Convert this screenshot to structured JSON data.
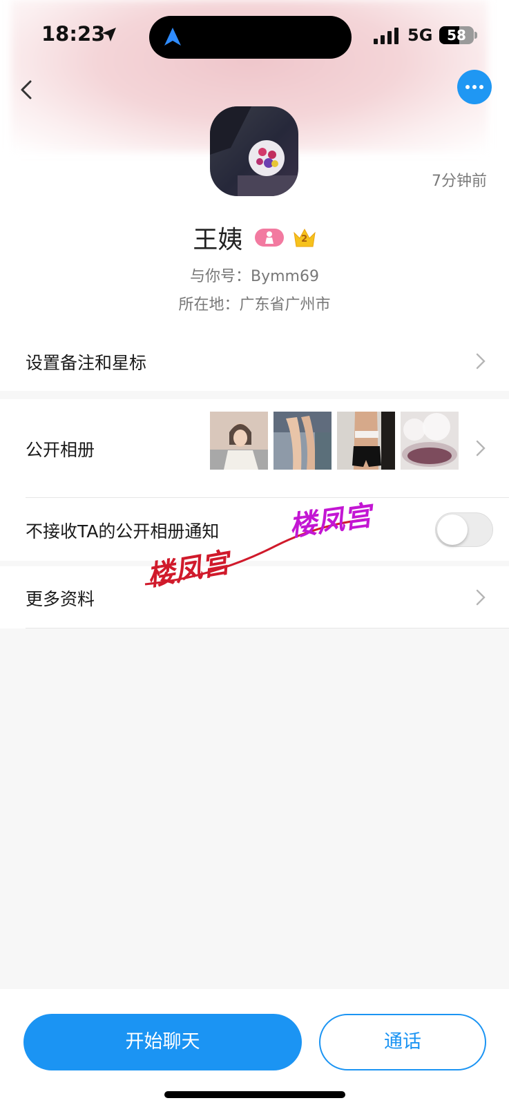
{
  "status_bar": {
    "time": "18:23",
    "network": "5G",
    "battery_text": "58",
    "battery_level": 0.58
  },
  "header": {
    "back_icon": "chevron-left-icon",
    "more_icon": "more-horizontal-icon",
    "accent_color": "#1f97f3"
  },
  "profile": {
    "last_active": "7分钟前",
    "name": "王姨",
    "gender_icon": "female-person-icon",
    "gender_badge_color": "#f27aa0",
    "level_icon": "crown-icon",
    "level_number": "2",
    "account_line": "与你号：Bymm69",
    "location_line": "所在地：广东省广州市"
  },
  "menu": {
    "remark_label": "设置备注和星标",
    "album_label": "公开相册",
    "album_notify_label": "不接收TA的公开相册通知",
    "album_notify_enabled": false,
    "more_info_label": "更多资料"
  },
  "watermark": {
    "text_red": "楼凤宫",
    "text_purple": "楼凤宫"
  },
  "footer": {
    "chat_button": "开始聊天",
    "call_button": "通话"
  }
}
